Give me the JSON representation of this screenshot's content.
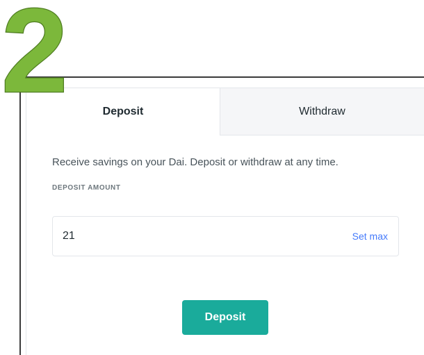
{
  "step": {
    "number": "2",
    "color": "#7cb83b",
    "outline_color": "#4f7d21"
  },
  "tabs": [
    {
      "label": "Deposit",
      "active": true
    },
    {
      "label": "Withdraw",
      "active": false
    }
  ],
  "description": "Receive savings on your Dai. Deposit or withdraw at any time.",
  "deposit_amount": {
    "label": "DEPOSIT AMOUNT",
    "value": "21",
    "set_max_label": "Set max"
  },
  "submit": {
    "label": "Deposit"
  },
  "colors": {
    "primary_button": "#1aab9b",
    "link": "#447afb",
    "inactive_tab_bg": "#f5f6f8"
  }
}
